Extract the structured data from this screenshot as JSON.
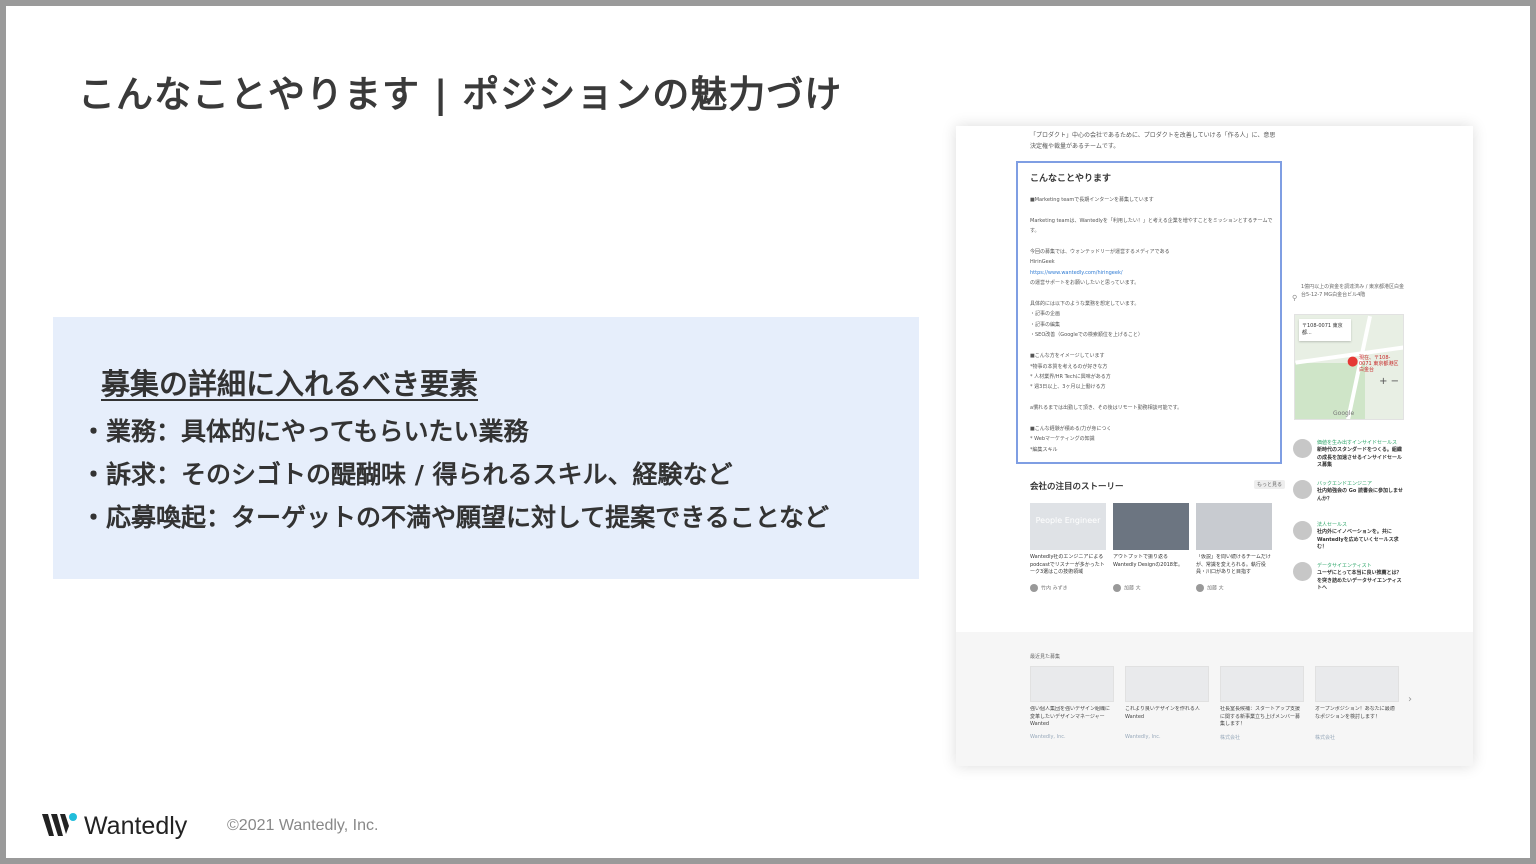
{
  "slide": {
    "title": "こんなことやります | ポジションの魅力づけ"
  },
  "infobox": {
    "heading": "募集の詳細に入れるべき要素",
    "lines": [
      "・業務：具体的にやってもらいたい業務",
      "・訴求：そのシゴトの醍醐味 / 得られるスキル、経験など",
      "・応募喚起：ターゲットの不満や願望に対して提案できることなど"
    ]
  },
  "screenshot": {
    "intro": "「プロダクト」中心の会社であるために、プロダクトを改善していける「作る人」に、意思決定権や裁量があるチームです。",
    "jd_title": "こんなことやります",
    "jd_body": [
      "■Marketing teamで長期インターンを募集しています",
      "",
      "Marketing teamは、Wantedlyを「利用したい！」と考える企業を増やすことをミッションとするチームです。",
      "",
      "今回の募集では、ウォンテッドリーが運営するメディアである",
      "HirinGeek",
      "https://www.wantedly.com/hiringeek/",
      "の運営サポートをお願いしたいと思っています。",
      "",
      "具体的には以下のような業務を想定しています。",
      "・記事の企画",
      "・記事の編集",
      "・SEO改善（Googleでの検索順位を上げること）",
      "",
      "■こんな方をイメージしています",
      "*物事の本質を考えるのが好きな方",
      "* 人材業界/HR Techに興味がある方",
      "* 週3日以上、3ヶ月以上働ける方",
      "",
      "a慣れるまでは出勤して頂き、その後はリモート勤務相談可能です。",
      "",
      "■こんな経験が積める/力が身につく",
      "* Webマーケティングの知識",
      "*編集スキル"
    ],
    "jd_link_index": 6,
    "side_info": "1億円以上の資金を調達済み / 東京都港区白金台5-12-7 MG白金台ビル4階",
    "map": {
      "card": "〒108-0071 東京都...",
      "pin_label": "現在、〒108-0071 東京都港区白金台",
      "zoom": "+ −",
      "google": "Google"
    },
    "people": [
      {
        "role": "価値を生み出すインサイドセールス",
        "text": "新時代のスタンダードをつくる。組織の成長を加速させるインサイドセールス募集"
      },
      {
        "role": "バックエンドエンジニア",
        "text": "社内勉強会の Go 読書会に参加しませんか？"
      },
      {
        "role": "法人セールス",
        "text": "社内外にイノベーションを。共にWantedlyを広めていくセールス求む！"
      },
      {
        "role": "データサイエンティスト",
        "text": "ユーザにとって本当に良い推薦とは？を突き詰めたいデータサイエンティストへ"
      }
    ],
    "stories_head": "会社の注目のストーリー",
    "stories_more": "もっと見る",
    "stories": [
      {
        "thumb": "People Engineer",
        "title": "Wantedly社のエンジニアによるpodcastでリスナーが多かったトーク3選はこの技術領域",
        "author": "竹内 みずき"
      },
      {
        "thumb": "",
        "title": "アウトプットで振り返るWantedly Designの2018年。",
        "author": "加藤 大"
      },
      {
        "thumb": "",
        "title": "「仮説」を問い続けるチームだけが、常識を変えられる。執行役員・川口がありと目指す",
        "author": "加藤 大"
      }
    ],
    "recent_head": "最近見た募集",
    "recents": [
      {
        "title": "強い個人集団を強いデザイン組織に変革したいデザインマネージャーWanted",
        "source": "Wantedly, Inc."
      },
      {
        "title": "これより良いデザインを作れる人Wanted",
        "source": "Wantedly, Inc."
      },
      {
        "title": "社長室長候補：スタートアップ支援に関する新事業立ち上げメンバー募集します！",
        "source": "株式会社"
      },
      {
        "title": "オープンポジション！あなたに最適なポジションを検討します！",
        "source": "株式会社"
      }
    ],
    "recent_arrow": "›"
  },
  "footer": {
    "logo_text": "Wantedly",
    "copyright": "©2021 Wantedly, Inc."
  },
  "colors": {
    "infobox_bg": "#e6eefb",
    "highlight_border": "#7f9ee3",
    "link": "#2e7bd4",
    "pin": "#e53935"
  }
}
